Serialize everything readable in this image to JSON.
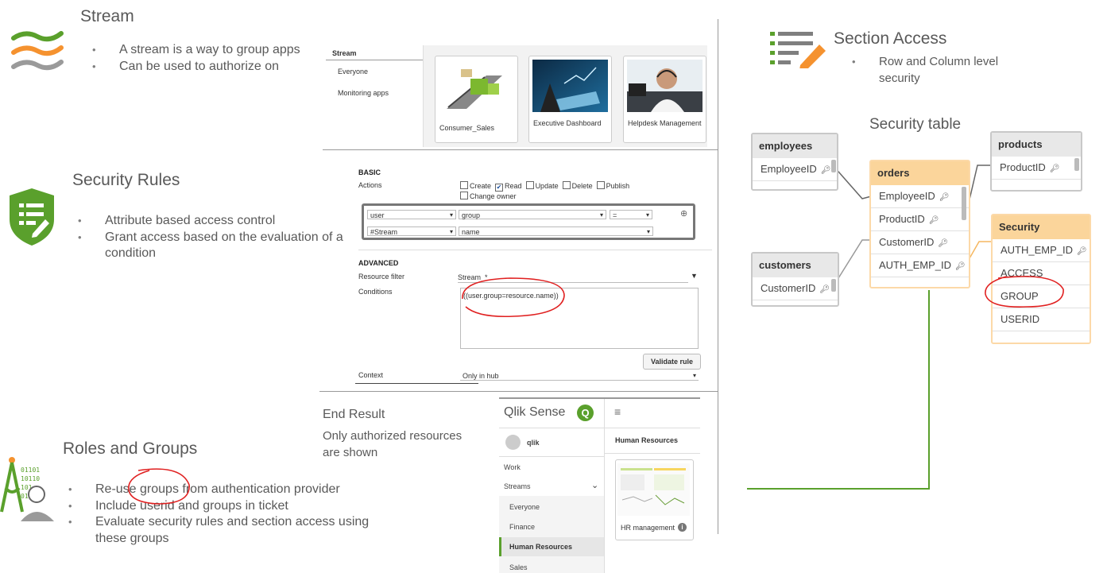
{
  "stream": {
    "title": "Stream",
    "bullets": [
      "A stream is a way to group apps",
      "Can be used to authorize on"
    ],
    "panel": {
      "header": "Stream",
      "items": [
        "Everyone",
        "Monitoring apps"
      ],
      "cards": [
        "Consumer_Sales",
        "Executive Dashboard",
        "Helpdesk Management"
      ]
    }
  },
  "security_rules": {
    "title": "Security Rules",
    "bullets": [
      "Attribute based access control",
      "Grant access based on the evaluation of a condition"
    ],
    "panel": {
      "basic_label": "BASIC",
      "actions_label": "Actions",
      "actions": [
        "Create",
        "Read",
        "Update",
        "Delete",
        "Publish",
        "Change owner"
      ],
      "row1": [
        "user",
        "group",
        "="
      ],
      "row2": [
        "#Stream",
        "name"
      ],
      "advanced_label": "ADVANCED",
      "resource_filter_label": "Resource filter",
      "resource_filter_value": "Stream_*",
      "conditions_label": "Conditions",
      "conditions_value": "((user.group=resource.name))",
      "validate_button": "Validate rule",
      "context_label": "Context",
      "context_value": "Only in hub"
    }
  },
  "end_result": {
    "title": "End Result",
    "subtitle": "Only authorized resources are shown"
  },
  "qlik": {
    "logo_text": "Qlik Sense",
    "logo_letter": "Q",
    "user": "qlik",
    "section_header": "Human Resources",
    "nav": [
      "Work",
      "Streams",
      "Everyone",
      "Finance",
      "Human Resources",
      "Sales"
    ],
    "app_card": "HR management"
  },
  "roles": {
    "title": "Roles and Groups",
    "bullets": [
      "Re-use groups from authentication provider",
      "Include userid and groups in ticket",
      "Evaluate security rules and section access using these groups"
    ],
    "icon_bits": "01101 10110 101 010"
  },
  "section_access": {
    "title": "Section Access",
    "bullets": [
      "Row and Column level security"
    ],
    "table_title": "Security table",
    "tables": {
      "employees": {
        "name": "employees",
        "fields": [
          "EmployeeID"
        ]
      },
      "orders": {
        "name": "orders",
        "fields": [
          "EmployeeID",
          "ProductID",
          "CustomerID",
          "AUTH_EMP_ID"
        ]
      },
      "products": {
        "name": "products",
        "fields": [
          "ProductID"
        ]
      },
      "customers": {
        "name": "customers",
        "fields": [
          "CustomerID"
        ]
      },
      "security": {
        "name": "Security",
        "fields": [
          "AUTH_EMP_ID",
          "ACCESS",
          "GROUP",
          "USERID"
        ]
      }
    }
  },
  "colors": {
    "green": "#5aa02c",
    "orange": "#f5922f",
    "gray": "#7f7f7f",
    "red": "#e02020",
    "pencil": "#f5922f"
  }
}
